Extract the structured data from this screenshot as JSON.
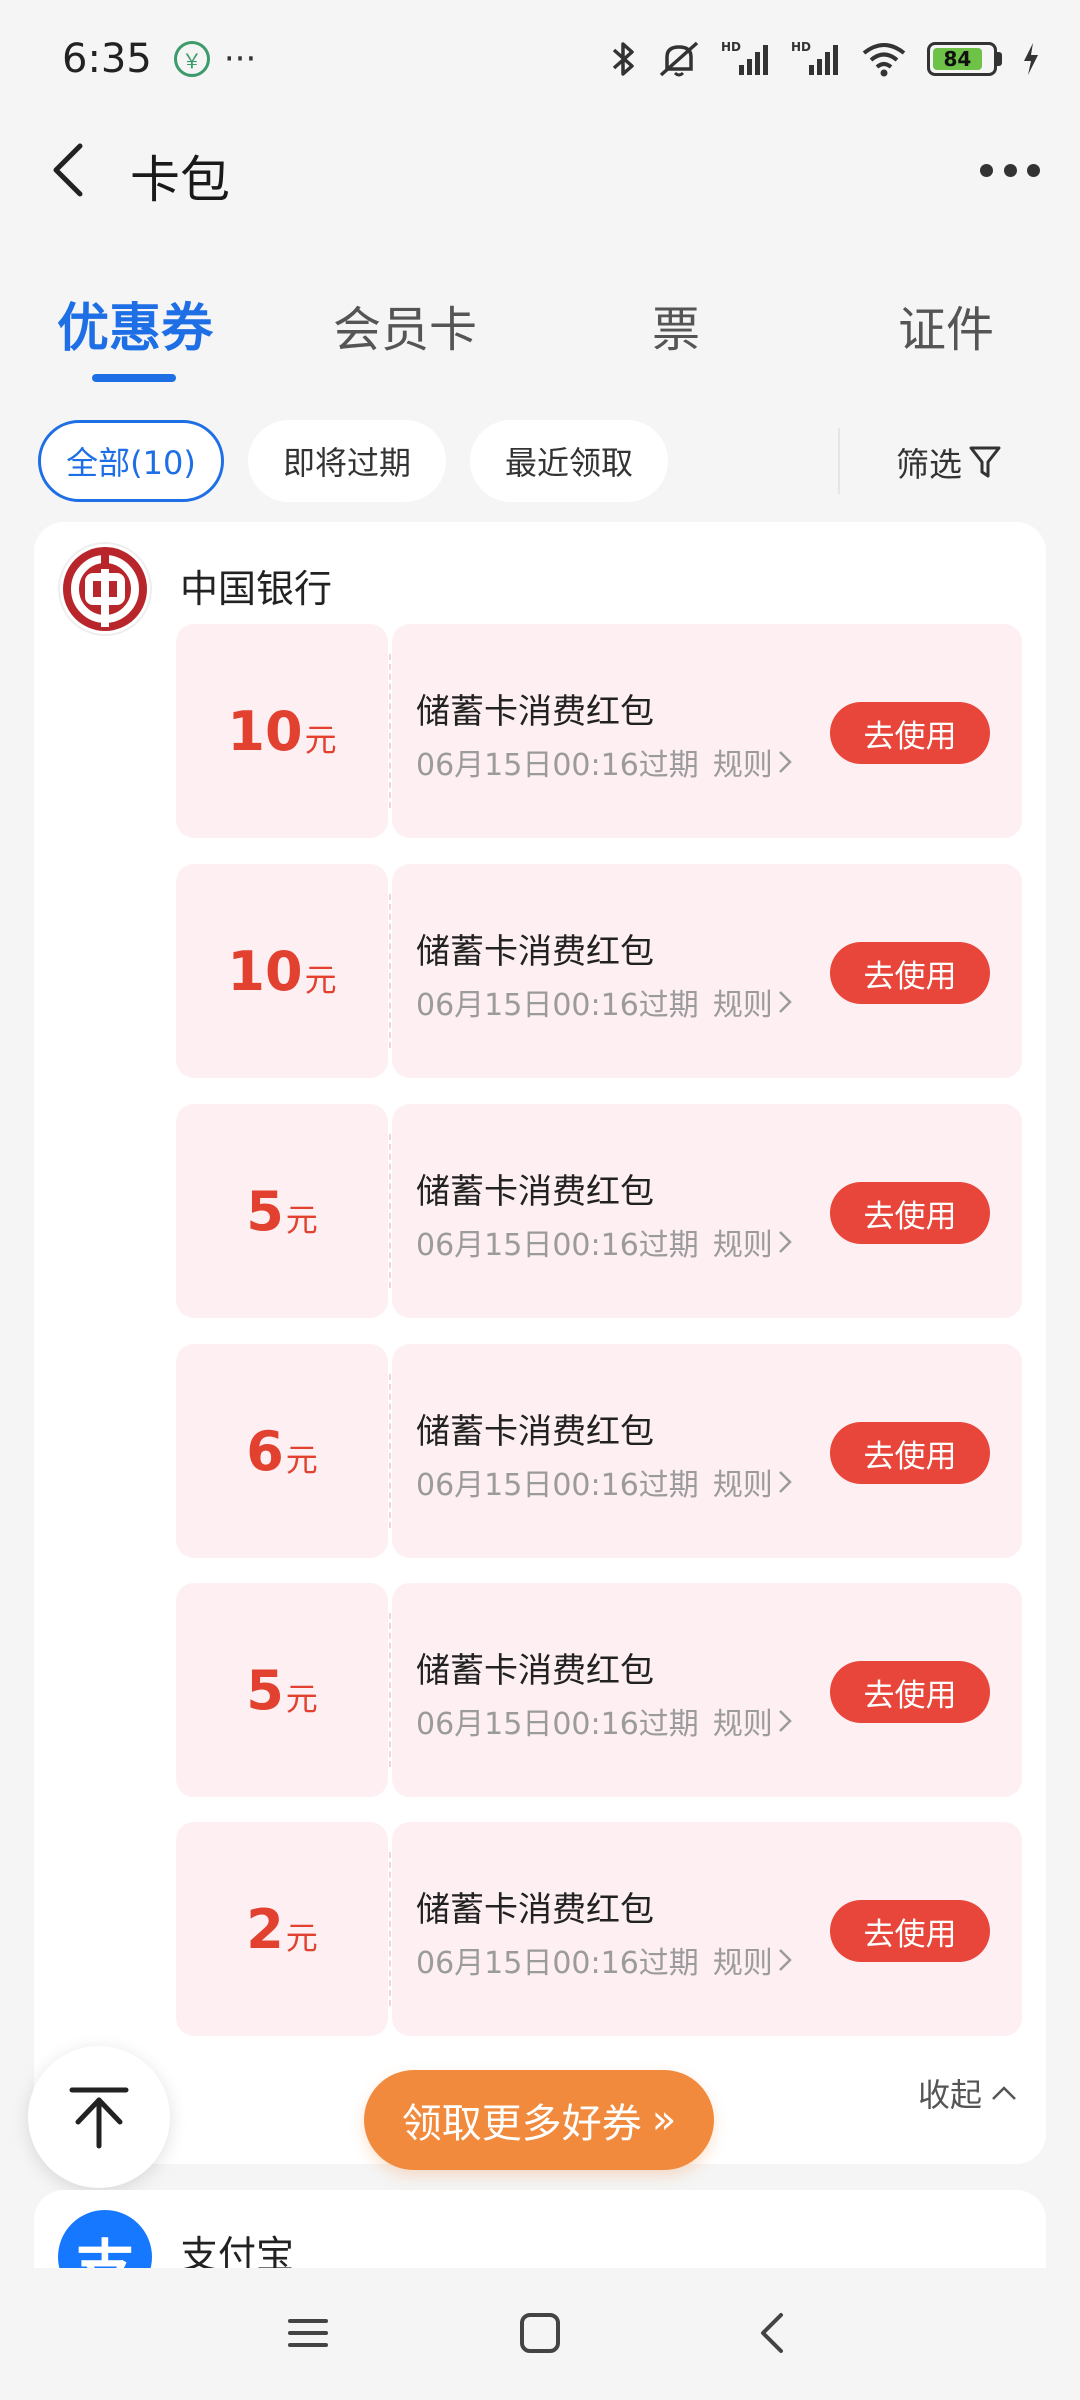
{
  "status_bar": {
    "time": "6:35",
    "dots": "···",
    "battery": "84",
    "icons": [
      "app-notification-icon",
      "bluetooth-icon",
      "mute-icon",
      "hd-signal-icon",
      "hd-signal-icon",
      "wifi-icon",
      "battery-icon",
      "charging-icon"
    ]
  },
  "header": {
    "title": "卡包"
  },
  "tabs": [
    {
      "label": "优惠券",
      "active": true
    },
    {
      "label": "会员卡",
      "active": false
    },
    {
      "label": "票",
      "active": false
    },
    {
      "label": "证件",
      "active": false
    }
  ],
  "filters": {
    "chips": [
      {
        "label": "全部(10)",
        "active": true
      },
      {
        "label": "即将过期",
        "active": false
      },
      {
        "label": "最近领取",
        "active": false
      }
    ],
    "filter_label": "筛选"
  },
  "bank_card": {
    "name": "中国银行",
    "coupons": [
      {
        "amount": "10",
        "unit": "元",
        "title": "储蓄卡消费红包",
        "expiry": "06月15日00:16过期",
        "rule": "规则",
        "action": "去使用"
      },
      {
        "amount": "10",
        "unit": "元",
        "title": "储蓄卡消费红包",
        "expiry": "06月15日00:16过期",
        "rule": "规则",
        "action": "去使用"
      },
      {
        "amount": "5",
        "unit": "元",
        "title": "储蓄卡消费红包",
        "expiry": "06月15日00:16过期",
        "rule": "规则",
        "action": "去使用"
      },
      {
        "amount": "6",
        "unit": "元",
        "title": "储蓄卡消费红包",
        "expiry": "06月15日00:16过期",
        "rule": "规则",
        "action": "去使用"
      },
      {
        "amount": "5",
        "unit": "元",
        "title": "储蓄卡消费红包",
        "expiry": "06月15日00:16过期",
        "rule": "规则",
        "action": "去使用"
      },
      {
        "amount": "2",
        "unit": "元",
        "title": "储蓄卡消费红包",
        "expiry": "06月15日00:16过期",
        "rule": "规则",
        "action": "去使用"
      }
    ],
    "collapse_label": "收起"
  },
  "more_coupons_label": "领取更多好券",
  "more_coupons_arrows": "»",
  "alipay_card": {
    "logo_char": "支",
    "name": "支付宝"
  },
  "colors": {
    "accent": "#1e6fe6",
    "coupon_red": "#e2412f",
    "use_button": "#e8463a",
    "coupon_bg": "#fdeff2",
    "more_button": "#f28a3d"
  }
}
